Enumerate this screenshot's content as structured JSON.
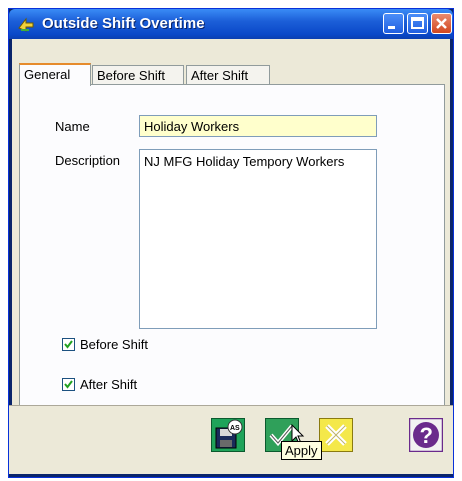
{
  "window": {
    "title": "Outside Shift Overtime",
    "title_icon": "arrow-icon"
  },
  "tabs": [
    {
      "label": "General",
      "active": true
    },
    {
      "label": "Before Shift",
      "active": false
    },
    {
      "label": "After Shift",
      "active": false
    }
  ],
  "form": {
    "name_label": "Name",
    "name_value": "Holiday Workers",
    "description_label": "Description",
    "description_value": "NJ MFG Holiday Tempory Workers",
    "before_shift": {
      "label": "Before Shift",
      "checked": true
    },
    "after_shift": {
      "label": "After Shift",
      "checked": true
    }
  },
  "toolbar": {
    "save_as_icon": "save-as-icon",
    "apply_icon": "apply-check-icon",
    "cancel_icon": "cancel-x-icon",
    "help_icon": "help-question-icon",
    "tooltip": "Apply"
  },
  "colors": {
    "titlebar": "#0a48c8",
    "name_field_bg": "#ffffcc",
    "apply_green": "#2fa05a",
    "cancel_yellow": "#f4e84a",
    "help_purple": "#6a2a8c"
  }
}
